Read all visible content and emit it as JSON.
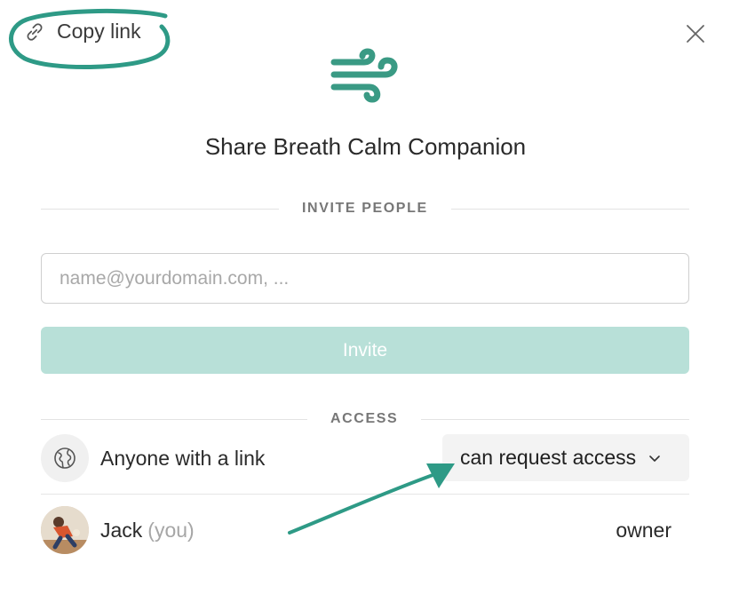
{
  "header": {
    "copy_link_label": "Copy link"
  },
  "dialog": {
    "title": "Share Breath Calm Companion"
  },
  "invite": {
    "section_label": "INVITE PEOPLE",
    "email_placeholder": "name@yourdomain.com, ...",
    "email_value": "",
    "button_label": "Invite"
  },
  "access": {
    "section_label": "ACCESS",
    "link_label": "Anyone with a link",
    "permission_value": "can request access"
  },
  "members": [
    {
      "name": "Jack",
      "you_label": "(you)",
      "role": "owner"
    }
  ],
  "icons": {
    "copy_link": "link-icon",
    "close": "close-icon",
    "logo": "wind-icon",
    "globe": "globe-icon",
    "chevron": "chevron-down-icon"
  },
  "colors": {
    "accent": "#2f9a85",
    "invite_button_bg": "#b8e0d8",
    "annotation": "#2e9a86"
  }
}
